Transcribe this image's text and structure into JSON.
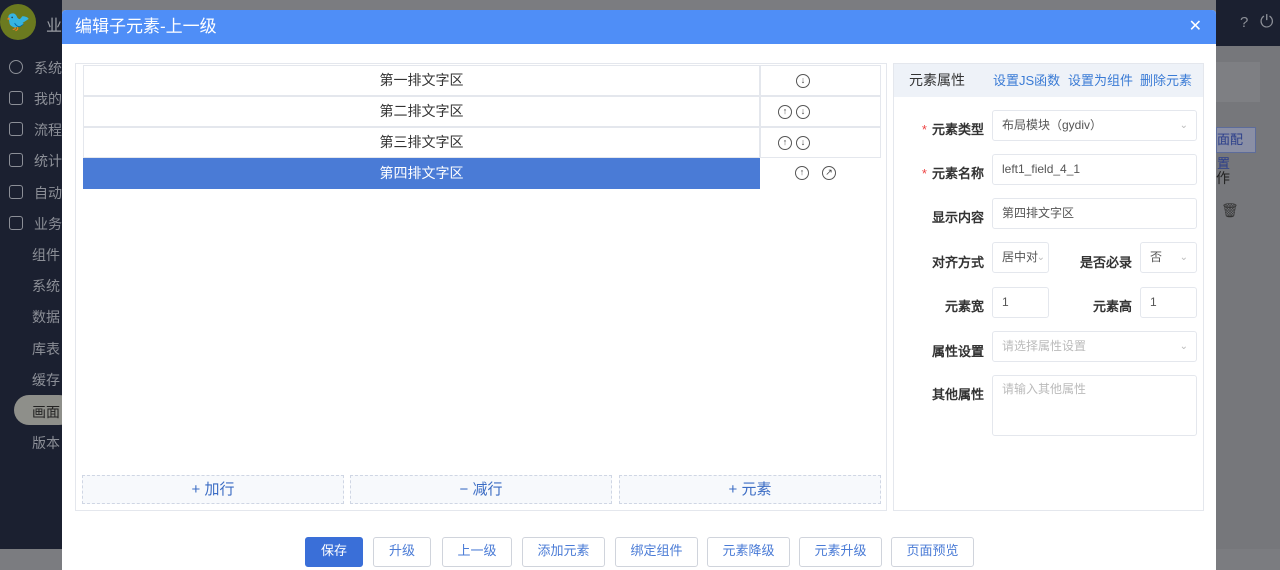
{
  "sidebar": {
    "app_title": "业",
    "items": [
      "系统",
      "我的",
      "流程",
      "统计",
      "自动",
      "业务"
    ],
    "subitems": [
      "组件",
      "系统",
      "数据",
      "库表",
      "缓存",
      "画面",
      "版本"
    ]
  },
  "background": {
    "button": "面配置",
    "column": "作"
  },
  "modal": {
    "title": "编辑子元素-上一级",
    "rows": [
      "第一排文字区",
      "第二排文字区",
      "第三排文字区",
      "第四排文字区"
    ],
    "add_row": "+ 加行",
    "remove_row": "− 减行",
    "add_element": "+ 元素",
    "props": {
      "title": "元素属性",
      "set_js": "设置JS函数",
      "set_component": "设置为组件",
      "delete": "删除元素",
      "type_label": "元素类型",
      "type_value": "布局模块（gydiv）",
      "name_label": "元素名称",
      "name_value": "left1_field_4_1",
      "content_label": "显示内容",
      "content_value": "第四排文字区",
      "align_label": "对齐方式",
      "align_value": "居中对",
      "required_label": "是否必录",
      "required_value": "否",
      "width_label": "元素宽",
      "width_value": "1",
      "height_label": "元素高",
      "height_value": "1",
      "attr_label": "属性设置",
      "attr_placeholder": "请选择属性设置",
      "other_label": "其他属性",
      "other_placeholder": "请输入其他属性"
    },
    "footer": [
      "保存",
      "升级",
      "上一级",
      "添加元素",
      "绑定组件",
      "元素降级",
      "元素升级",
      "页面预览"
    ]
  }
}
